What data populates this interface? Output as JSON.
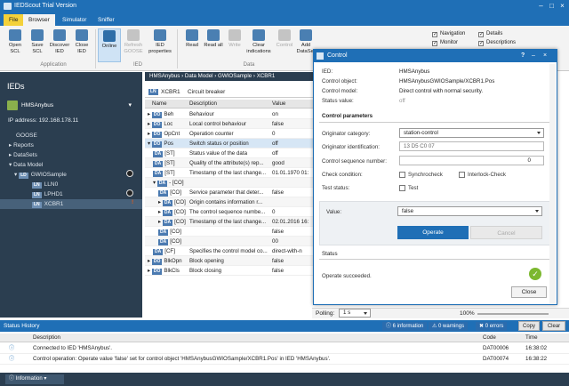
{
  "window": {
    "title": "IEDScout Trial Version"
  },
  "tabs": [
    "File",
    "Browser",
    "Simulator",
    "Sniffer"
  ],
  "ribbon": {
    "buttons": [
      {
        "label": "Open SCL"
      },
      {
        "label": "Save SCL"
      },
      {
        "label": "Discover IED"
      },
      {
        "label": "Close IED"
      },
      {
        "label": "Online"
      },
      {
        "label": "Refresh GOOSE"
      },
      {
        "label": "IED properties"
      },
      {
        "label": "Read"
      },
      {
        "label": "Read all"
      },
      {
        "label": "Write"
      },
      {
        "label": "Clear indications"
      },
      {
        "label": "Control"
      },
      {
        "label": "Add DataSet"
      }
    ],
    "groups": {
      "application": "Application",
      "ied": "IED",
      "data": "Data"
    },
    "view_checks": [
      "Navigation",
      "Details",
      "Monitor",
      "Descriptions"
    ]
  },
  "left": {
    "header": "IEDs",
    "device": "HMSAnybus",
    "ip_label": "IP address: 192.168.178.11",
    "tree": [
      "GOOSE",
      "Reports",
      "DataSets",
      "Data Model",
      "GWIOSample",
      "LLN0",
      "LPHD1",
      "XCBR1"
    ],
    "ln_tag": "LN",
    "ld_tag": "LD"
  },
  "middle": {
    "breadcrumb": "HMSAnybus › Data Model › GWIOSample › XCBR1",
    "object_name": "XCBR1",
    "object_desc": "Circuit breaker",
    "columns": [
      "Name",
      "Description",
      "Value"
    ],
    "rows": [
      {
        "tag": "DO",
        "name": "Beh",
        "desc": "Behaviour",
        "value": "on"
      },
      {
        "tag": "DO",
        "name": "Loc",
        "desc": "Local control behaviour",
        "value": "false"
      },
      {
        "tag": "DO",
        "name": "OpCnt",
        "desc": "Operation counter",
        "value": "0"
      },
      {
        "tag": "DO",
        "name": "Pos",
        "desc": "Switch status or position",
        "value": "off"
      },
      {
        "tag": "DA",
        "name": "[ST]",
        "desc": "Status value of the data",
        "value": "off"
      },
      {
        "tag": "DA",
        "name": "[ST]",
        "desc": "Quality of the attribute(s) rep...",
        "value": "good"
      },
      {
        "tag": "DA",
        "name": "[ST]",
        "desc": "Timestamp of the last change...",
        "value": "01.01.1970 01:"
      },
      {
        "tag": "DA",
        "name": "- [CO]",
        "desc": "",
        "value": ""
      },
      {
        "tag": "DA",
        "name": "[CO]",
        "desc": "Service parameter that deter...",
        "value": "false"
      },
      {
        "tag": "DA",
        "name": "[CO]",
        "desc": "Origin contains information r...",
        "value": ""
      },
      {
        "tag": "DA",
        "name": "[CO]",
        "desc": "The control sequence numbe...",
        "value": "0"
      },
      {
        "tag": "DA",
        "name": "[CO]",
        "desc": "Timestamp of the last change...",
        "value": "02.01.2016 16:"
      },
      {
        "tag": "DA",
        "name": "[CO]",
        "desc": "",
        "value": "false"
      },
      {
        "tag": "DA",
        "name": "[CO]",
        "desc": "",
        "value": "00"
      },
      {
        "tag": "DA",
        "name": "[CF]",
        "desc": "Specifies the control model co...",
        "value": "direct-with-n"
      },
      {
        "tag": "DO",
        "name": "BlkOpn",
        "desc": "Block opening",
        "value": "false"
      },
      {
        "tag": "DO",
        "name": "BlkCls",
        "desc": "Block closing",
        "value": "false"
      }
    ],
    "polling_label": "Polling:",
    "polling_value": "1 s",
    "zoom": "100%"
  },
  "dialog": {
    "title": "Control",
    "ied_label": "IED:",
    "ied": "HMSAnybus",
    "object_label": "Control object:",
    "object": "HMSAnybusGWIOSample/XCBR1.Pos",
    "model_label": "Control model:",
    "model": "Direct control with normal security.",
    "status_label": "Status value:",
    "status": "off",
    "params_header": "Control parameters",
    "cat_label": "Originator category:",
    "cat": "station-control",
    "ident_label": "Originator identification:",
    "ident": "13 D5 C0 07",
    "seq_label": "Control sequence number:",
    "seq": "0",
    "check_label": "Check condition:",
    "sync": "Synchrocheck",
    "interlock": "Interlock-Check",
    "test_label": "Test status:",
    "test": "Test",
    "value_label": "Value:",
    "value": "false",
    "operate": "Operate",
    "cancel": "Cancel",
    "status_header": "Status",
    "result": "Operate succeeded.",
    "close": "Close"
  },
  "status_history": {
    "title": "Status History",
    "info_count": "6 information",
    "warn_count": "0 warnings",
    "err_count": "0 errors",
    "copy": "Copy",
    "clear": "Clear",
    "columns": [
      "Description",
      "Code",
      "Time"
    ],
    "rows": [
      {
        "desc": "Connected to IED 'HMSAnybus'.",
        "code": "DAT00006",
        "time": "16:38:02"
      },
      {
        "desc": "Control operation: Operate value 'false' set for control object 'HMSAnybusGWIOSample/XCBR1.Pos' in IED 'HMSAnybus'.",
        "code": "DAT00074",
        "time": "16:38:22"
      }
    ],
    "filter": "Information"
  },
  "colors": {
    "accent": "#1f6fb6",
    "panel": "#2b3e50",
    "ok": "#7cb82f"
  }
}
